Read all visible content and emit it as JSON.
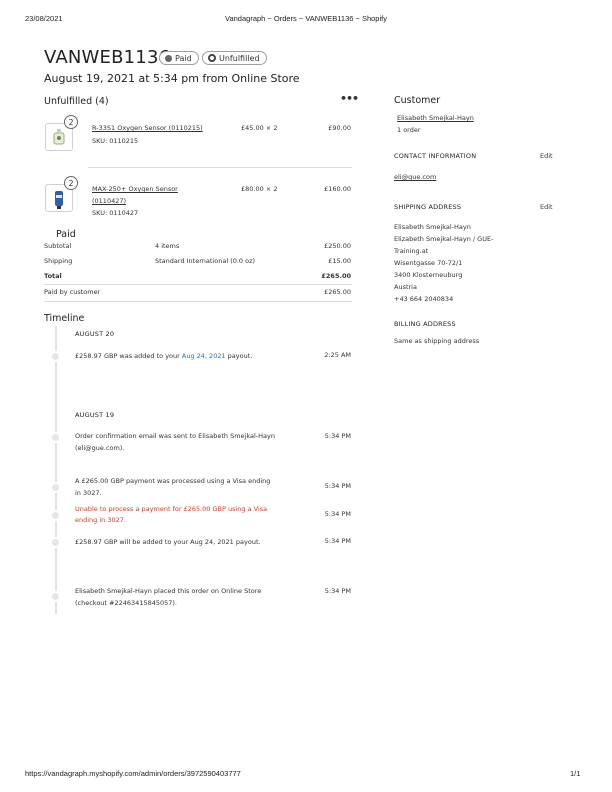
{
  "print_header": {
    "date": "23/08/2021",
    "page_title": "Vandagraph ~ Orders ~ VANWEB1136 ~ Shopify"
  },
  "print_footer": {
    "url": "https://vandagraph.myshopify.com/admin/orders/3972590403777",
    "page": "1/1"
  },
  "order": {
    "number": "VANWEB1136",
    "payment_status": "Paid",
    "fulfillment_status": "Unfulfilled",
    "subtitle": "August 19, 2021 at 5:34 pm from Online Store"
  },
  "unfulfilled": {
    "heading": "Unfulfilled (4)",
    "more_icon": "ellipsis-icon",
    "items": [
      {
        "qty": "2",
        "name": "R-33S1 Oxygen Sensor (0110215)",
        "sku": "SKU: 0110215",
        "price": "£45.00 × 2",
        "total": "£90.00"
      },
      {
        "qty": "2",
        "name_line1": "MAX-250+ Oxygen Sensor",
        "name_line2": "(0110427)",
        "sku": "SKU: 0110427",
        "price": "£80.00 × 2",
        "total": "£160.00"
      }
    ]
  },
  "payment": {
    "heading": "Paid",
    "rows": [
      {
        "label": "Subtotal",
        "detail": "4 items",
        "amount": "£250.00"
      },
      {
        "label": "Shipping",
        "detail": "Standard International (0.0 oz)",
        "amount": "£15.00"
      },
      {
        "label": "Total",
        "detail": "",
        "amount": "£265.00"
      },
      {
        "label": "Paid by customer",
        "detail": "",
        "amount": "£265.00"
      }
    ]
  },
  "timeline": {
    "heading": "Timeline",
    "groups": [
      {
        "date": "AUGUST 20",
        "events": [
          {
            "text_before": "£258.97 GBP was added to your ",
            "link": "Aug 24, 2021",
            "text_after": " payout.",
            "time": "2:25 AM"
          }
        ]
      },
      {
        "date": "AUGUST 19",
        "events": [
          {
            "line1": "Order confirmation email was sent to Elisabeth Smejkal-Hayn",
            "line2": "(eli@gue.com).",
            "time": "5:34 PM"
          },
          {
            "line1": "A £265.00 GBP payment was processed using a Visa ending",
            "line2": "in 3027.",
            "time": "5:34 PM"
          },
          {
            "line1": "Unable to process a payment for £265.00 GBP using a Visa",
            "line2": "ending in 3027.",
            "time": "5:34 PM"
          },
          {
            "line1": "£258.97 GBP will be added to your Aug 24, 2021 payout.",
            "time": "5:34 PM"
          },
          {
            "line1": "Elisabeth Smejkal-Hayn placed this order on Online Store",
            "line2": "(checkout #22463415845057).",
            "time": "5:34 PM"
          }
        ]
      }
    ]
  },
  "customer": {
    "heading": "Customer",
    "name": "Elisabeth Smejkal-Hayn",
    "orders": "1 order",
    "contact_heading": "CONTACT INFORMATION",
    "contact_edit": "Edit",
    "email": "eli@gue.com",
    "shipping_heading": "SHIPPING ADDRESS",
    "shipping_edit": "Edit",
    "address_lines": [
      "Elisabeth Smejkal-Hayn",
      "Elizabeth Smejkal-Hayn / GUE-",
      "Training.at",
      "Wisentgasse 70-72/1",
      "3400 Klosterneuburg",
      "Austria",
      "+43 664 2040834"
    ],
    "billing_heading": "BILLING ADDRESS",
    "billing_text": "Same as shipping address"
  },
  "colors": {
    "link_blue": "#2b6fc2",
    "error_red": "#d8381f"
  }
}
